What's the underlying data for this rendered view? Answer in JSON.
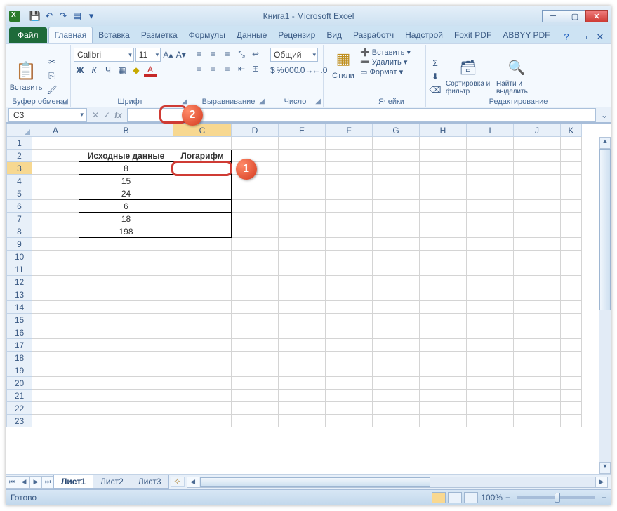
{
  "window": {
    "title": "Книга1 - Microsoft Excel"
  },
  "qat_icons": {
    "save": "💾",
    "undo": "↶",
    "redo": "↷",
    "new": "▤"
  },
  "ribbon_tabs": {
    "file": "Файл",
    "items": [
      "Главная",
      "Вставка",
      "Разметка",
      "Формулы",
      "Данные",
      "Рецензир",
      "Вид",
      "Разработч",
      "Надстрой",
      "Foxit PDF",
      "ABBYY PDF"
    ],
    "active": 0
  },
  "ribbon": {
    "clipboard": {
      "paste": "Вставить",
      "label": "Буфер обмена"
    },
    "font": {
      "name": "Calibri",
      "size": "11",
      "label": "Шрифт",
      "bold": "Ж",
      "italic": "К",
      "under": "Ч"
    },
    "align": {
      "label": "Выравнивание"
    },
    "number": {
      "fmt": "Общий",
      "label": "Число"
    },
    "styles": {
      "btn": "Стили"
    },
    "cells": {
      "insert": "Вставить",
      "delete": "Удалить",
      "format": "Формат",
      "label": "Ячейки"
    },
    "editing": {
      "sort": "Сортировка и фильтр",
      "find": "Найти и выделить",
      "label": "Редактирование"
    }
  },
  "formula_bar": {
    "name": "C3",
    "fx": "fx"
  },
  "columns": [
    "A",
    "B",
    "C",
    "D",
    "E",
    "F",
    "G",
    "H",
    "I",
    "J",
    "K"
  ],
  "col_widths": {
    "A": 67,
    "B": 134,
    "C": 83,
    "D": 67,
    "E": 67,
    "F": 67,
    "G": 67,
    "H": 67,
    "I": 67,
    "J": 67,
    "K": 30
  },
  "rows_visible": 23,
  "selected_cell": {
    "row": 3,
    "col": "C"
  },
  "sheet_data": {
    "headers": {
      "B": "Исходные данные",
      "C": "Логарифм"
    },
    "values": {
      "3": "8",
      "4": "15",
      "5": "24",
      "6": "6",
      "7": "18",
      "8": "198"
    }
  },
  "callouts": {
    "fx": "2",
    "cell": "1"
  },
  "sheets": {
    "tabs": [
      "Лист1",
      "Лист2",
      "Лист3"
    ],
    "active": 0
  },
  "status": {
    "ready": "Готово",
    "zoom": "100%"
  }
}
